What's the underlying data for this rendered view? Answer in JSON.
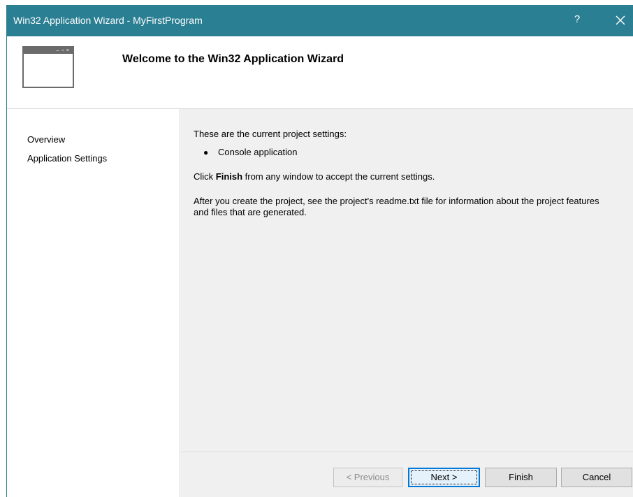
{
  "window": {
    "title": "Win32 Application Wizard - MyFirstProgram",
    "help_label": "?",
    "colors": {
      "titlebar": "#2b7f93",
      "content_bg": "#f0f0f0",
      "default_button_border": "#0078d7"
    }
  },
  "header": {
    "icon": "window-icon",
    "title": "Welcome to the Win32 Application Wizard"
  },
  "sidebar": {
    "items": [
      {
        "label": "Overview"
      },
      {
        "label": "Application Settings"
      }
    ]
  },
  "content": {
    "settings_intro": "These are the current project settings:",
    "settings": [
      {
        "label": "Console application"
      }
    ],
    "finish_prefix": "Click ",
    "finish_bold": "Finish",
    "finish_suffix": " from any window to accept the current settings.",
    "readme_note": "After you create the project, see the project's readme.txt file for information about the project features and files that are generated."
  },
  "buttons": {
    "previous": "< Previous",
    "next": "Next >",
    "finish": "Finish",
    "cancel": "Cancel"
  }
}
